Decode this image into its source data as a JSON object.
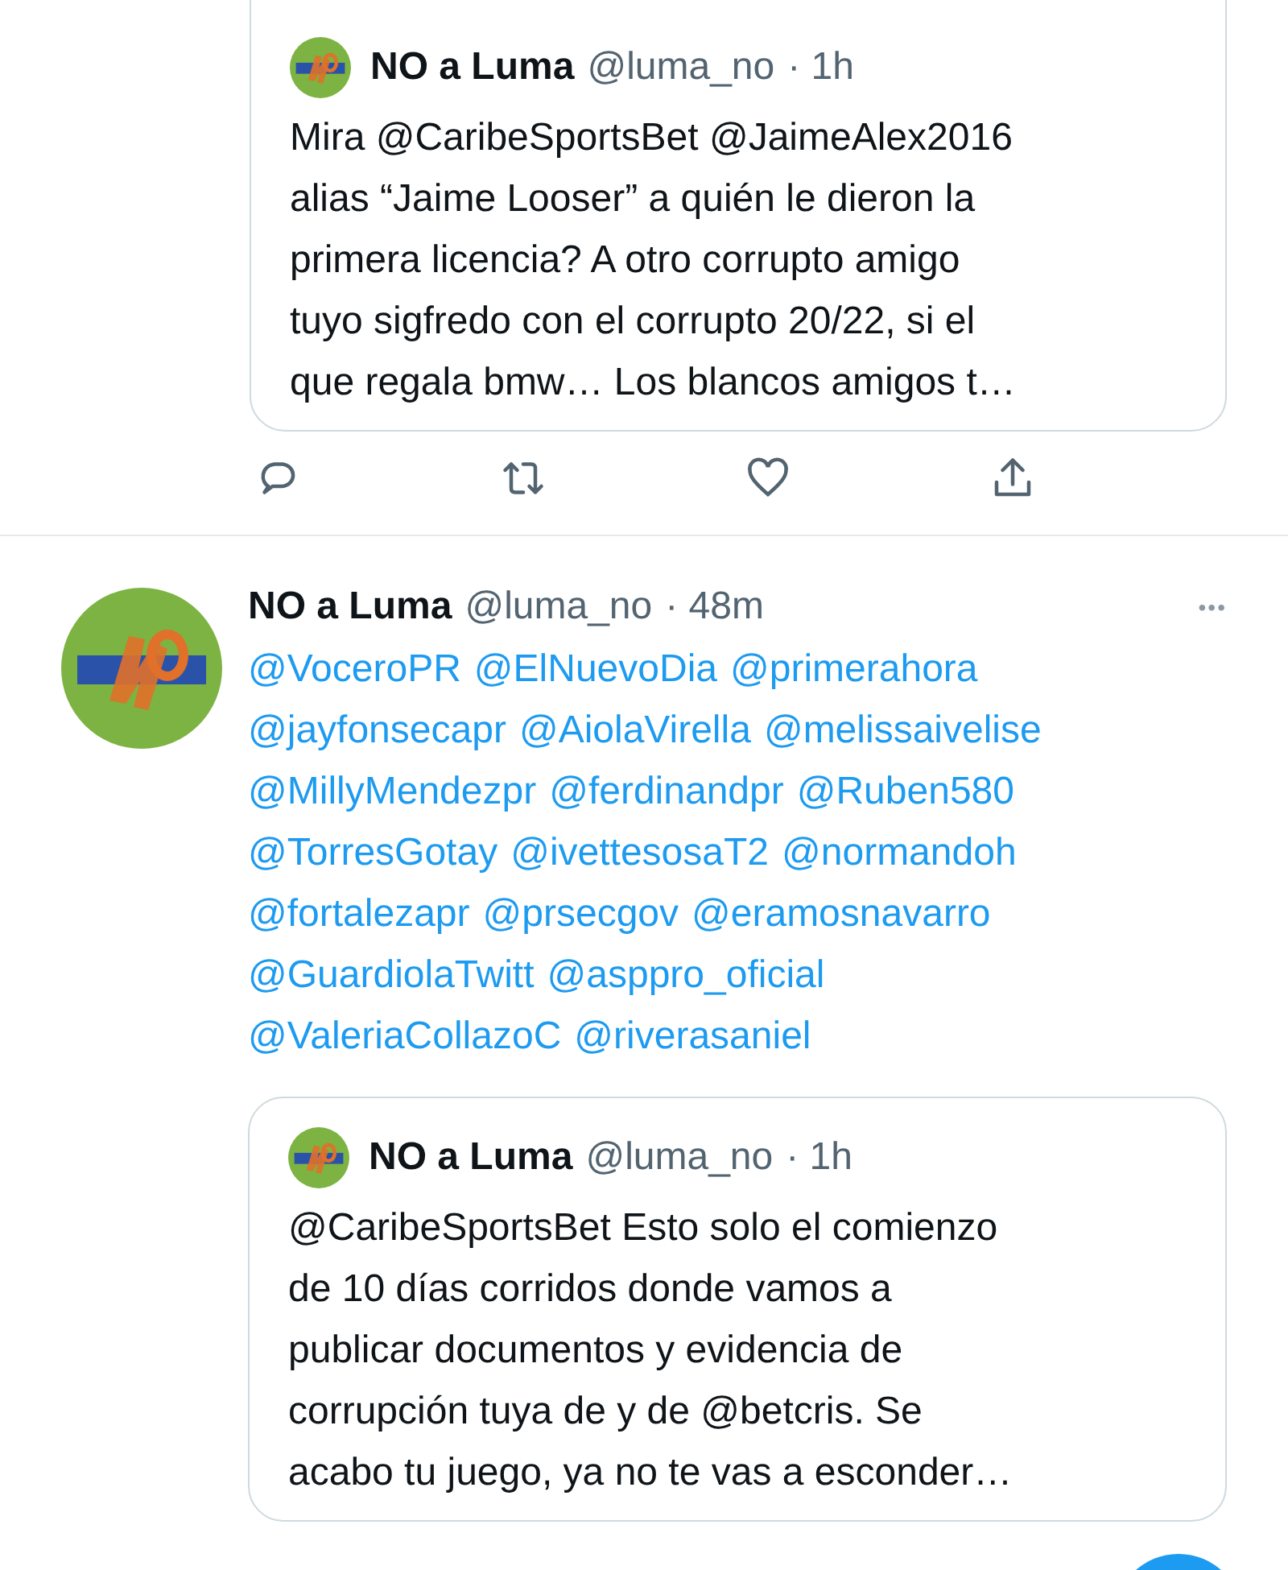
{
  "quoted_top": {
    "name": "NO a Luma",
    "handle": "@luma_no",
    "time": "· 1h",
    "text_lines": [
      "Mira @CaribeSportsBet @JaimeAlex2016",
      "alias “Jaime Looser” a quién le dieron la",
      "primera licencia? A otro corrupto amigo",
      "tuyo sigfredo con el corrupto 20/22, si el",
      "que regala bmw… Los blancos amigos t…"
    ]
  },
  "tweet": {
    "name": "NO a Luma",
    "handle": "@luma_no",
    "time": "· 48m",
    "more": "•••",
    "mention_lines": [
      [
        "@VoceroPR",
        "@ElNuevoDia",
        "@primerahora"
      ],
      [
        "@jayfonsecapr",
        "@AiolaVirella",
        "@melissaivelise"
      ],
      [
        "@MillyMendezpr",
        "@ferdinandpr",
        "@Ruben580"
      ],
      [
        "@TorresGotay",
        "@ivettesosaT2",
        "@normandoh"
      ],
      [
        "@fortalezapr",
        "@prsecgov",
        "@eramosnavarro"
      ],
      [
        "@GuardiolaTwitt",
        "@asppro_oficial"
      ],
      [
        "@ValeriaCollazoC",
        "@riverasaniel"
      ]
    ],
    "quoted": {
      "name": "NO a Luma",
      "handle": "@luma_no",
      "time": "· 1h",
      "text_lines": [
        "@CaribeSportsBet Esto solo el comienzo",
        "de 10 días corridos donde vamos a",
        "publicar documentos y evidencia de",
        "corrupción tuya de y de @betcris. Se",
        "acabo tu juego, ya no te vas a esconder…"
      ]
    }
  }
}
